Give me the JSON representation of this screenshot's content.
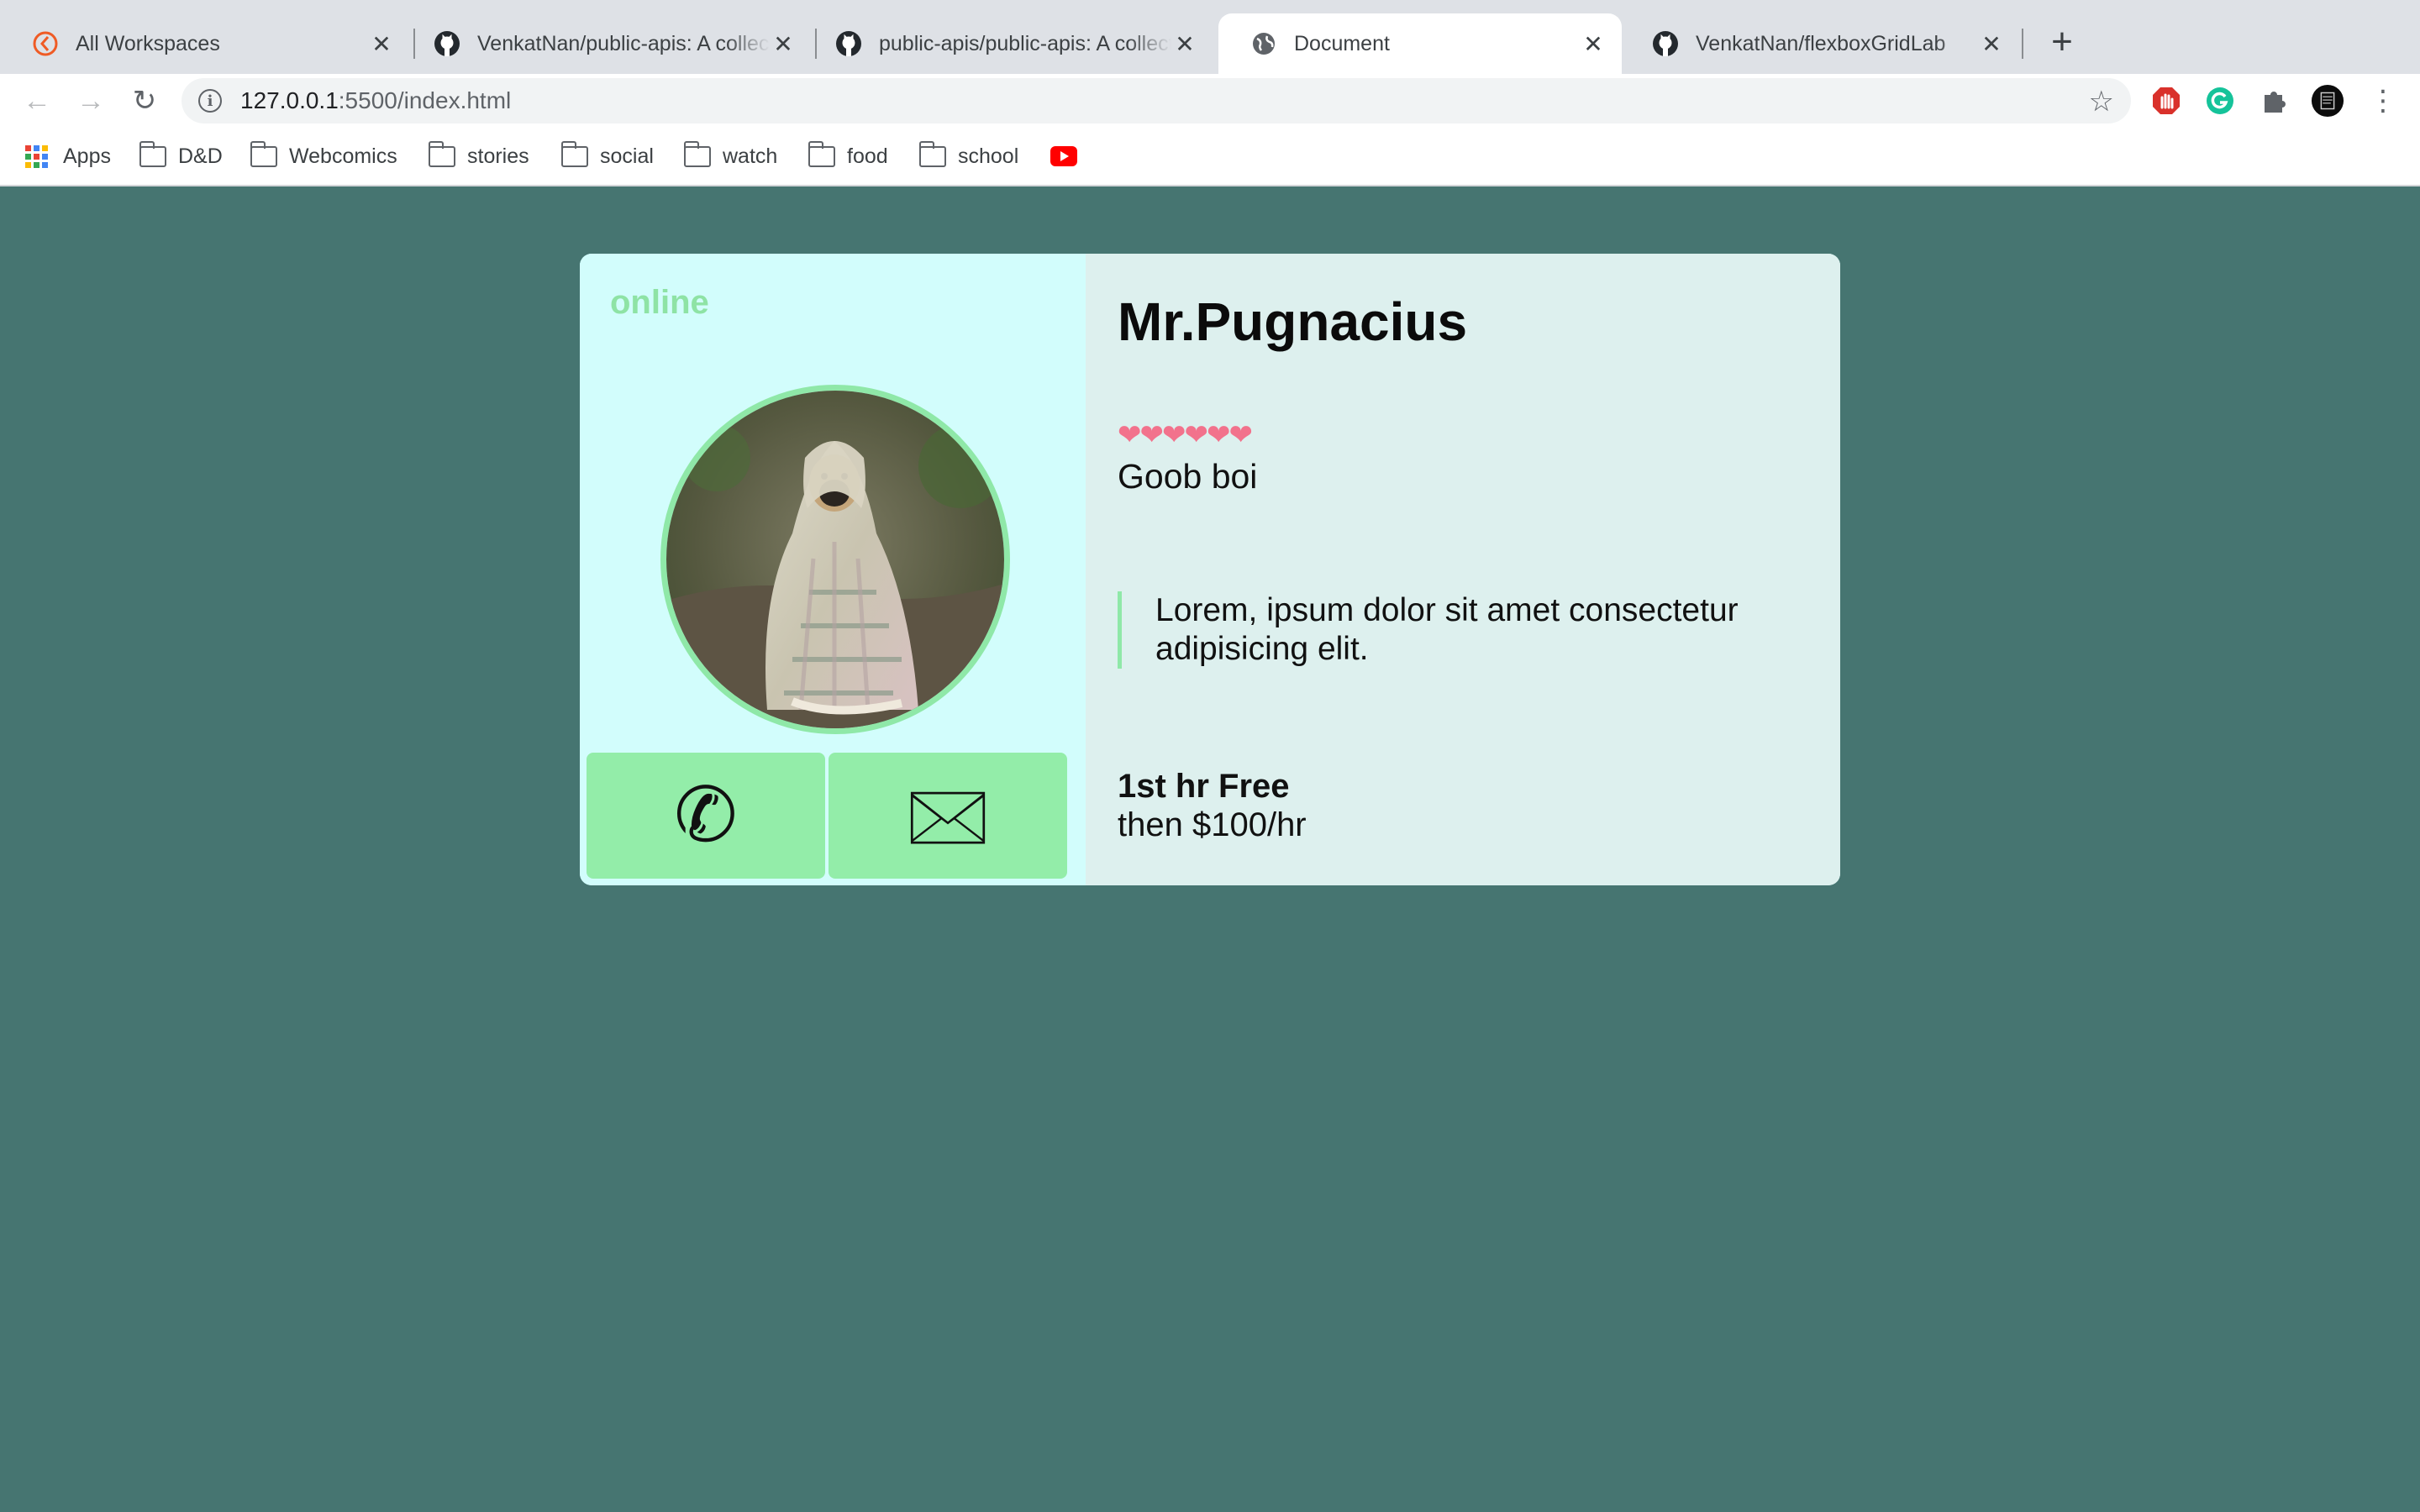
{
  "browser": {
    "tabs": [
      {
        "title": "All Workspaces",
        "icon": "workspace-icon"
      },
      {
        "title": "VenkatNan/public-apis: A collective list of free APIs",
        "icon": "github-icon"
      },
      {
        "title": "public-apis/public-apis: A collective list of free APIs",
        "icon": "github-icon"
      },
      {
        "title": "Document",
        "icon": "globe-icon",
        "active": true
      },
      {
        "title": "VenkatNan/flexboxGridLab",
        "icon": "github-icon"
      }
    ],
    "address": {
      "host": "127.0.0.1",
      "rest": ":5500/index.html"
    },
    "bookmarks": {
      "apps": "Apps",
      "folders": [
        "D&D",
        "Webcomics",
        "stories",
        "social",
        "watch",
        "food",
        "school"
      ]
    }
  },
  "card": {
    "status": "online",
    "name": "Mr.Pugnacius",
    "hearts": "❤❤❤❤❤❤",
    "tagline": "Goob boi",
    "quote": "Lorem, ipsum dolor sit amet consectetur adipisicing elit.",
    "price_main": "1st hr Free",
    "price_sub": "then $100/hr",
    "call_glyph": "✆",
    "mail_glyph": "🖂"
  },
  "colors": {
    "page_bg": "#467571",
    "card_left": "#d2fdfc",
    "card_right": "#ddf0ee",
    "accent_green": "#93eda9",
    "status_green": "#8ee3a5",
    "hearts": "#f2728c"
  }
}
